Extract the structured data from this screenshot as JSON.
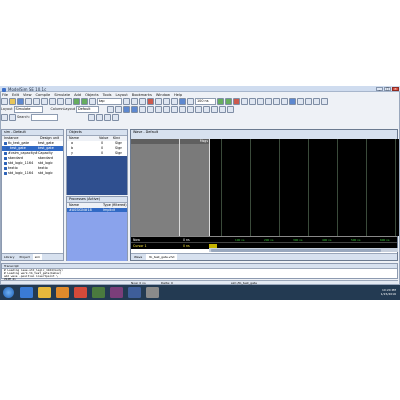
{
  "window": {
    "title": "ModelSim SE 10.1c"
  },
  "menu": [
    "File",
    "Edit",
    "View",
    "Compile",
    "Simulate",
    "Add",
    "Objects",
    "Tools",
    "Layout",
    "Bookmarks",
    "Window",
    "Help"
  ],
  "toolbar": {
    "search_value": "tap",
    "time_value": "100 ns",
    "layout_label": "Layout",
    "layout_value": "Simulate",
    "colorscheme_label": "ColumnLayout",
    "colorscheme_value": "Default",
    "search2_label": "Search:"
  },
  "workspace": {
    "header": "sim - Default",
    "columns": [
      "Instance",
      "Design unit"
    ],
    "rows": [
      {
        "name": "tb_test_gate",
        "unit": "test_gate"
      },
      {
        "name": "test_gate",
        "unit": "test_gate"
      },
      {
        "name": "#vsim_capacity#",
        "unit": "Capacity"
      },
      {
        "name": "standard",
        "unit": "standard"
      },
      {
        "name": "std_logic_1164",
        "unit": "std_logic"
      },
      {
        "name": "textio",
        "unit": "textio"
      },
      {
        "name": "std_logic_1164",
        "unit": "std_logic"
      }
    ],
    "tabs": [
      "Library",
      "Project",
      "sim"
    ]
  },
  "objects": {
    "header": "Objects",
    "columns": [
      "Name",
      "Value",
      "Kind"
    ],
    "rows": [
      {
        "name": "a",
        "value": "0",
        "kind": "Sign"
      },
      {
        "name": "b",
        "value": "0",
        "kind": "Sign"
      },
      {
        "name": "y",
        "value": "0",
        "kind": "Sign"
      }
    ]
  },
  "processes": {
    "header": "Processes (Active)",
    "columns": [
      "Name",
      "Type (filtered)"
    ],
    "rows": [
      {
        "name": "#ASSIGN#18",
        "type": "Implicit"
      }
    ]
  },
  "wave": {
    "header": "Wave - Default",
    "msgs_label": "Msgs",
    "now_label": "Now",
    "now_value": "0 ns",
    "cursor_label": "Cursor 1",
    "cursor_value": "0 ns",
    "ticks": [
      "100 ns",
      "200 ns",
      "300 ns",
      "400 ns",
      "500 ns",
      "600 ns"
    ],
    "tabs": [
      "Wave",
      "tb_test_gate.vhd"
    ]
  },
  "transcript": {
    "header": "Transcript",
    "lines": [
      "# Loading ieee.std_logic_1164(body)",
      "# Loading work.tb_test_gate(behav)",
      "add wave -position insertpoint \\",
      "VSIM 4>"
    ]
  },
  "statusbar": {
    "now": "Now: 0 ns",
    "delta": "Delta: 0",
    "path": "sim:/tb_test_gate"
  },
  "tray": {
    "time": "10:20 PM",
    "date": "1/15/2016"
  }
}
